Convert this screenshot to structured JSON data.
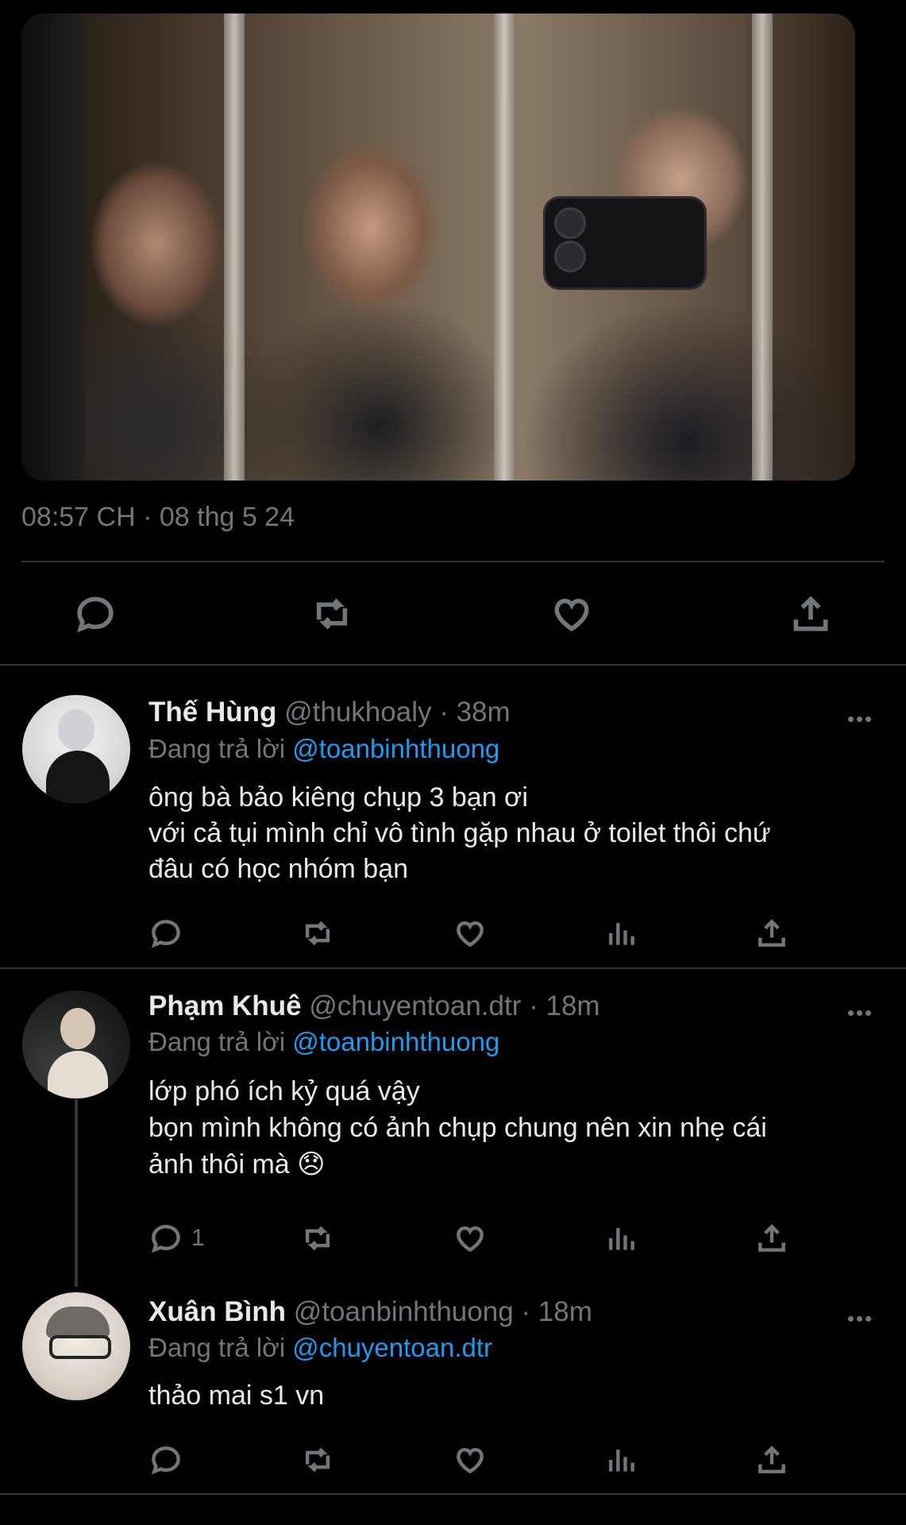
{
  "tweet": {
    "timestamp": "08:57 CH · 08 thg 5 24"
  },
  "replies": [
    {
      "name": "Thế Hùng",
      "handle": "@thukhoaly",
      "time": "38m",
      "replying_prefix": "Đang trả lời",
      "replying_to": "@toanbinhthuong",
      "lines": [
        "ông bà bảo kiêng chụp 3 bạn ơi",
        "với cả tụi mình chỉ vô tình gặp nhau ở toilet thôi chứ",
        "đâu có học nhóm bạn"
      ],
      "reply_count": ""
    },
    {
      "name": "Phạm Khuê",
      "handle": "@chuyentoan.dtr",
      "time": "18m",
      "replying_prefix": "Đang trả lời",
      "replying_to": "@toanbinhthuong",
      "lines": [
        "lớp phó ích kỷ quá vậy",
        "bọn mình không có ảnh chụp chung nên xin nhẹ cái",
        "ảnh thôi mà 😞"
      ],
      "reply_count": "1"
    },
    {
      "name": "Xuân Bình",
      "handle": "@toanbinhthuong",
      "time": "18m",
      "replying_prefix": "Đang trả lời",
      "replying_to": "@chuyentoan.dtr",
      "lines": [
        "thảo mai s1 vn"
      ],
      "reply_count": ""
    }
  ],
  "icons": {
    "reply": "reply-icon",
    "retweet": "retweet-icon",
    "like": "heart-icon",
    "views": "analytics-icon",
    "share": "share-icon",
    "more": "more-icon"
  },
  "colors": {
    "background": "#000000",
    "text": "#e7e9ea",
    "muted": "#71767b",
    "mention": "#1d9bf0",
    "divider": "#2f3336"
  }
}
